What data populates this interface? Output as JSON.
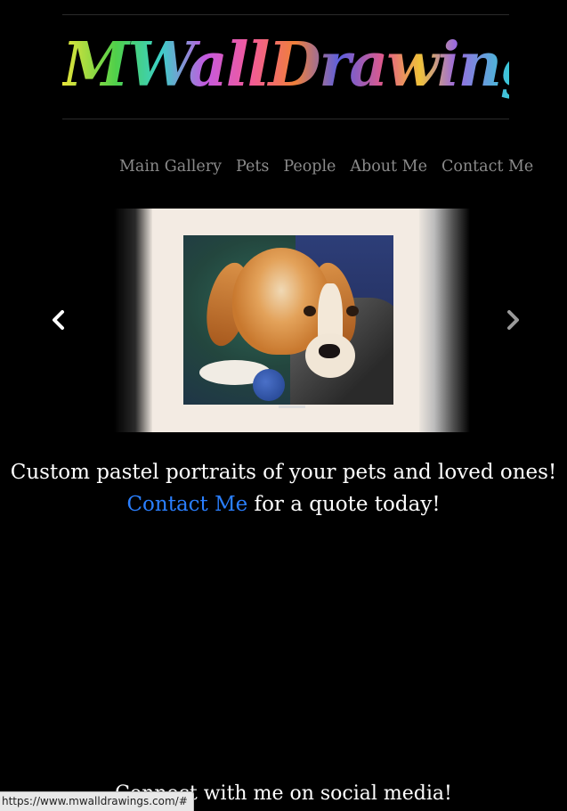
{
  "header": {
    "logo_text": "MWallDrawings"
  },
  "nav": {
    "items": [
      {
        "label": "Main Gallery"
      },
      {
        "label": "Pets"
      },
      {
        "label": "People"
      },
      {
        "label": "About Me"
      },
      {
        "label": "Contact Me"
      }
    ]
  },
  "carousel": {
    "prev_icon": "chevron-left-icon",
    "next_icon": "chevron-right-icon",
    "slide_image": "beagle-pastel-portrait"
  },
  "main": {
    "tagline": "Custom pastel portraits of your pets and loved ones!",
    "cta_link": "Contact Me",
    "cta_rest": " for a quote today!",
    "social_heading": "Connect with me on social media!"
  },
  "status": {
    "url": "https://www.mwalldrawings.com/#"
  },
  "colors": {
    "background": "#000000",
    "link": "#2a7fff",
    "nav": "#8a8a8a"
  }
}
